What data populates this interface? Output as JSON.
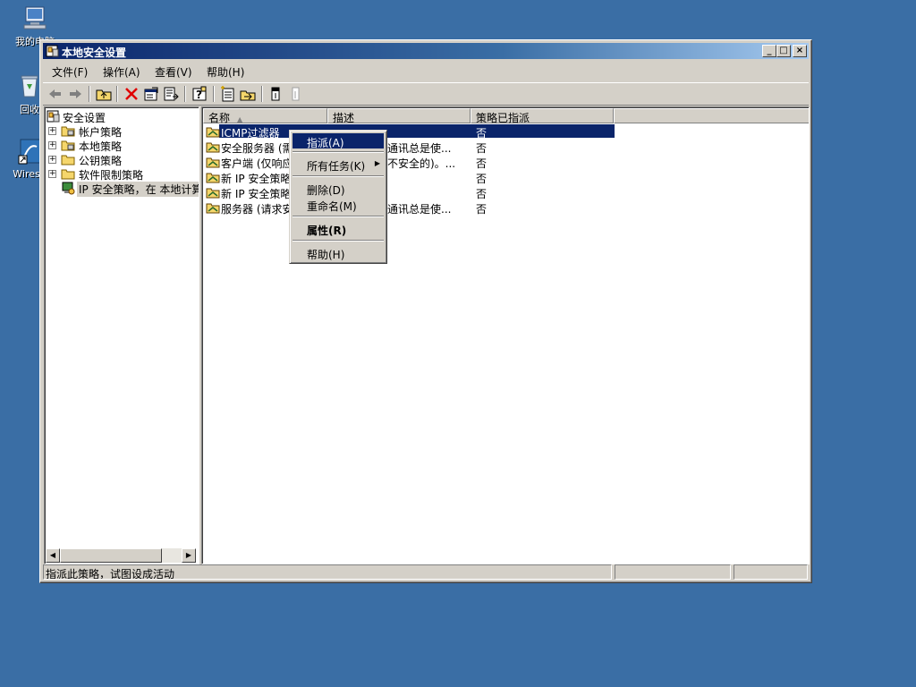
{
  "desktop": {
    "icons": [
      {
        "label": "我的电脑",
        "icon": "my-computer-icon"
      },
      {
        "label": "回收",
        "icon": "recycle-bin-icon"
      },
      {
        "label": "Wiresh",
        "icon": "wireshark-shortcut-icon"
      }
    ]
  },
  "window": {
    "title": "本地安全设置",
    "controls": {
      "minimize": "_",
      "maximize": "□",
      "close": "×"
    }
  },
  "menubar": [
    "文件(F)",
    "操作(A)",
    "查看(V)",
    "帮助(H)"
  ],
  "toolbar": {
    "buttons": [
      "back-icon",
      "forward-icon",
      "up-folder-icon",
      "delete-icon",
      "properties-icon",
      "export-list-icon",
      "help-icon",
      "new-policy-icon",
      "manage-filters-icon",
      "assign-icon",
      "unassign-icon"
    ]
  },
  "tree": {
    "root": "安全设置",
    "items": [
      {
        "label": "帐户策略",
        "expander": "+"
      },
      {
        "label": "本地策略",
        "expander": "+"
      },
      {
        "label": "公钥策略",
        "expander": "+"
      },
      {
        "label": "软件限制策略",
        "expander": "+"
      },
      {
        "label": "IP 安全策略，在 本地计算机"
      }
    ]
  },
  "list": {
    "columns": [
      "名称",
      "描述",
      "策略已指派"
    ],
    "rows": [
      {
        "name": "ICMP过滤器",
        "description": "",
        "assigned": "否",
        "selected": true
      },
      {
        "name": "安全服务器 (需",
        "description": "通讯总是使...",
        "assigned": "否"
      },
      {
        "name": "客户端 (仅响应",
        "description": "不安全的)。...",
        "assigned": "否"
      },
      {
        "name": "新 IP 安全策略",
        "description": "",
        "assigned": "否"
      },
      {
        "name": "新 IP 安全策略",
        "description": "",
        "assigned": "否"
      },
      {
        "name": "服务器 (请求安",
        "description": "通讯总是使...",
        "assigned": "否"
      }
    ]
  },
  "context_menu": {
    "items": [
      {
        "label": "指派(A)"
      },
      {
        "label": "所有任务(K)",
        "submenu": "▶"
      },
      {
        "label": "删除(D)"
      },
      {
        "label": "重命名(M)"
      },
      {
        "label": "属性(R)"
      },
      {
        "label": "帮助(H)"
      }
    ]
  },
  "status": {
    "text": "指派此策略，试图设成活动",
    "panel2": "",
    "panel3": ""
  }
}
